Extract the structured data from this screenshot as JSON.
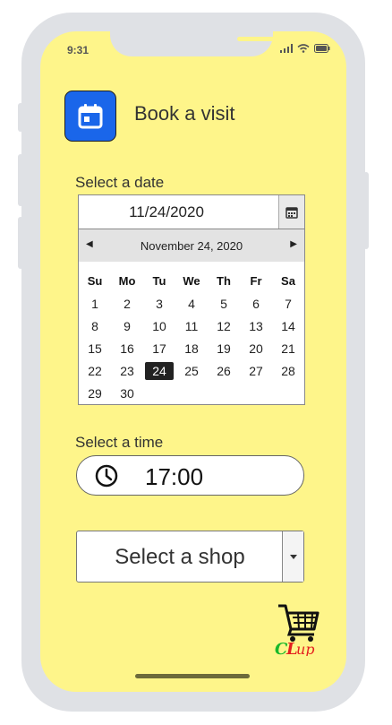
{
  "status_bar": {
    "time": "9:31"
  },
  "header": {
    "title": "Book a visit",
    "icon": "calendar-icon",
    "icon_color": "#1a66ea"
  },
  "date_section": {
    "label": "Select a date",
    "value": "11/24/2020",
    "calendar": {
      "month_title": "November 24, 2020",
      "weekdays": [
        "Su",
        "Mo",
        "Tu",
        "We",
        "Th",
        "Fr",
        "Sa"
      ],
      "weeks": [
        [
          "1",
          "2",
          "3",
          "4",
          "5",
          "6",
          "7"
        ],
        [
          "8",
          "9",
          "10",
          "11",
          "12",
          "13",
          "14"
        ],
        [
          "15",
          "16",
          "17",
          "18",
          "19",
          "20",
          "21"
        ],
        [
          "22",
          "23",
          "24",
          "25",
          "26",
          "27",
          "28"
        ],
        [
          "29",
          "30",
          "",
          "",
          "",
          "",
          ""
        ]
      ],
      "selected_day": "24"
    }
  },
  "time_section": {
    "label": "Select a time",
    "value": "17:00",
    "icon": "clock-icon"
  },
  "shop_section": {
    "label": "Select a shop"
  },
  "logo": {
    "text": "CLup",
    "icon": "shopping-cart-icon"
  },
  "colors": {
    "screen_background": "#fef58a",
    "frame": "#dfe1e5",
    "selected_day": "#222222"
  }
}
